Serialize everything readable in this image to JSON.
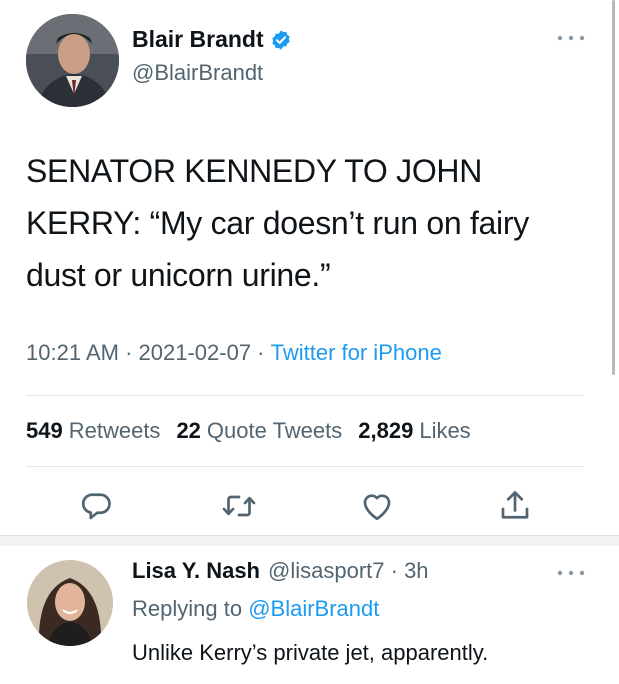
{
  "tweet": {
    "author_name": "Blair Brandt",
    "author_handle": "@BlairBrandt",
    "text": "SENATOR KENNEDY TO JOHN KERRY: “My car doesn’t run on fairy dust or unicorn urine.”",
    "time": "10:21 AM",
    "date": "2021-02-07",
    "source": "Twitter for iPhone",
    "meta_sep": " · ",
    "retweets_count": "549",
    "retweets_label": "Retweets",
    "quotes_count": "22",
    "quotes_label": "Quote Tweets",
    "likes_count": "2,829",
    "likes_label": "Likes"
  },
  "reply": {
    "author_name": "Lisa Y. Nash",
    "author_handle": "@lisasport7",
    "time": "3h",
    "time_sep": " · ",
    "replying_prefix": "Replying to",
    "replying_to": "@BlairBrandt",
    "text": "Unlike Kerry’s private jet, apparently."
  },
  "icons": {
    "verified": "verified-badge-icon",
    "more": "more-dots-icon",
    "reply": "reply-icon",
    "retweet": "retweet-icon",
    "like": "heart-icon",
    "share": "share-icon"
  },
  "colors": {
    "accent": "#1d9bf0",
    "secondary_text": "#536471",
    "primary_text": "#0f1419"
  }
}
